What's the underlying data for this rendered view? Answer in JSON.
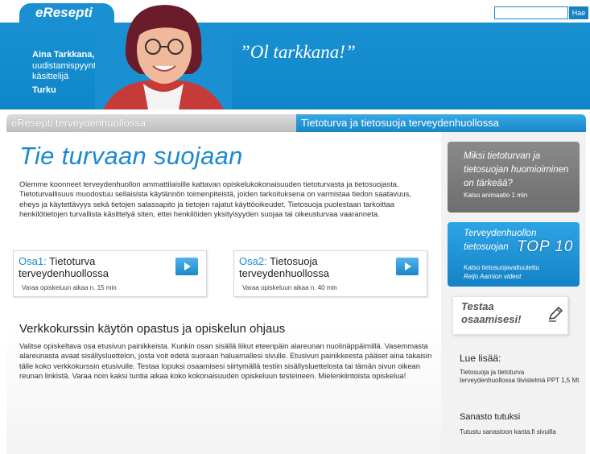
{
  "header": {
    "logo": "eResepti",
    "search_placeholder": "",
    "search_button": "Hae",
    "person_name": "Aina Tarkkana,",
    "person_role": "uudistamispyyntöjen käsittelijä",
    "person_city": "Turku",
    "quote": "”Ol tarkkana!”"
  },
  "nav": {
    "left_label": "eResepti terveydenhuollossa",
    "right_label": "Tietoturva ja tietosuoja terveydenhuollossa"
  },
  "main": {
    "title": "Tie turvaan suojaan",
    "intro": "Olemme koonneet terveydenhuollon ammattilaisille kattavan opiskelukokonaisuuden tietoturvasta ja tietosuojasta. Tietoturvallisuus muodostuu sellaisista käytännön toimenpiteistä, joiden tarkoituksena on varmistaa tiedon saatavuus, eheys ja käytettävyys sekä tietojen salassapito ja tietojen rajatut käyttöoikeudet. Tietosuoja puolestaan tarkoittaa henkilötietojen turvallista käsittelyä siten, ettei henkilöiden yksityisyyden suojaa tai oikeusturvaa vaaranneta.",
    "courses": [
      {
        "prefix": "Osa1:",
        "title": "Tietoturva terveydenhuollossa",
        "note": "Varaa opiskeluun aikaa n. 15 min"
      },
      {
        "prefix": "Osa2:",
        "title": "Tietosuoja terveydenhuollossa",
        "note": "Varaa opiskeluun aikaa n. 40 min"
      }
    ],
    "guide_title": "Verkkokurssin käytön opastus ja opiskelun ohjaus",
    "guide_text": "Valitse opiskeltava osa etusivun painikkeista. Kunkin osan sisällä liikut eteenpäin alareunan nuolinäppäimillä. Vasemmasta alareunasta avaat sisällysluettelon, josta voit edetä suoraan haluamallesi sivulle. Etusivun painikkeesta pääset aina takaisin tälle koko verkkokurssin etusivulle. Testaa lopuksi osaamisesi siirtymällä testiin sisällysluettelosta tai tämän sivun oikean reunan linkistä. Varaa noin kaksi tuntia aikaa koko kokonaisuuden opiskeluun testeineen. Mielenkiintoista opiskelua!"
  },
  "sidebar": {
    "box1_title": "Miksi tietoturvan ja tietosuojan huomioiminen on tärkeää?",
    "box1_note": "Katso animaatio 1 min",
    "box2_title": "Terveydenhuollon tietosuojan",
    "box2_top": "TOP 10",
    "box2_note1": "Katso tietosuojavaltuutettu",
    "box2_note2": "Reijo Aarnion videot",
    "testaa": "Testaa osaamisesi!",
    "lue_title": "Lue lisää:",
    "lue_link": "Tietosuoja ja tietoturva terveydenhuollossa tiivistelmä PPT 1,5 Mt",
    "sanasto_title": "Sanasto tutuksi",
    "sanasto_link": "Tutustu sanastoon kanta.fi sivuilla"
  }
}
